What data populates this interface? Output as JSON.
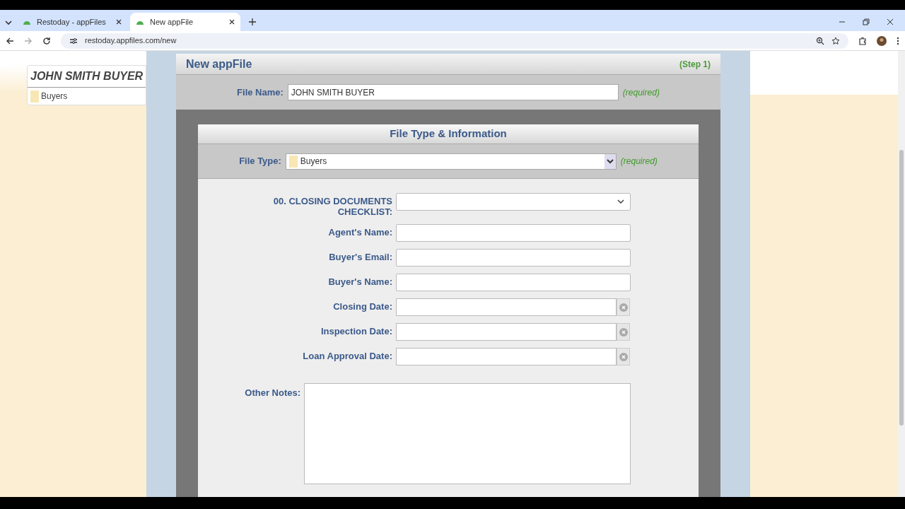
{
  "browser": {
    "tabs": [
      {
        "title": "Restoday - appFiles",
        "selected": false
      },
      {
        "title": "New appFile",
        "selected": true
      }
    ],
    "url": "restoday.appfiles.com/new"
  },
  "sidebar": {
    "file_title": "JOHN SMITH BUYER",
    "file_type": "Buyers"
  },
  "panel": {
    "title": "New appFile",
    "step": "(Step 1)",
    "file_name_label": "File Name:",
    "file_name_value": "JOHN SMITH BUYER",
    "required": "(required)"
  },
  "section": {
    "title": "File Type & Information",
    "file_type_label": "File Type:",
    "file_type_value": "Buyers",
    "required": "(required)"
  },
  "fields": [
    {
      "kind": "select",
      "label": "00. CLOSING DOCUMENTS CHECKLIST:"
    },
    {
      "kind": "text",
      "label": "Agent's Name:"
    },
    {
      "kind": "text",
      "label": "Buyer's Email:"
    },
    {
      "kind": "text",
      "label": "Buyer's Name:"
    },
    {
      "kind": "date",
      "label": "Closing Date:"
    },
    {
      "kind": "date",
      "label": "Inspection Date:"
    },
    {
      "kind": "date",
      "label": "Loan Approval Date:"
    },
    {
      "kind": "textarea",
      "label": "Other Notes:"
    }
  ]
}
